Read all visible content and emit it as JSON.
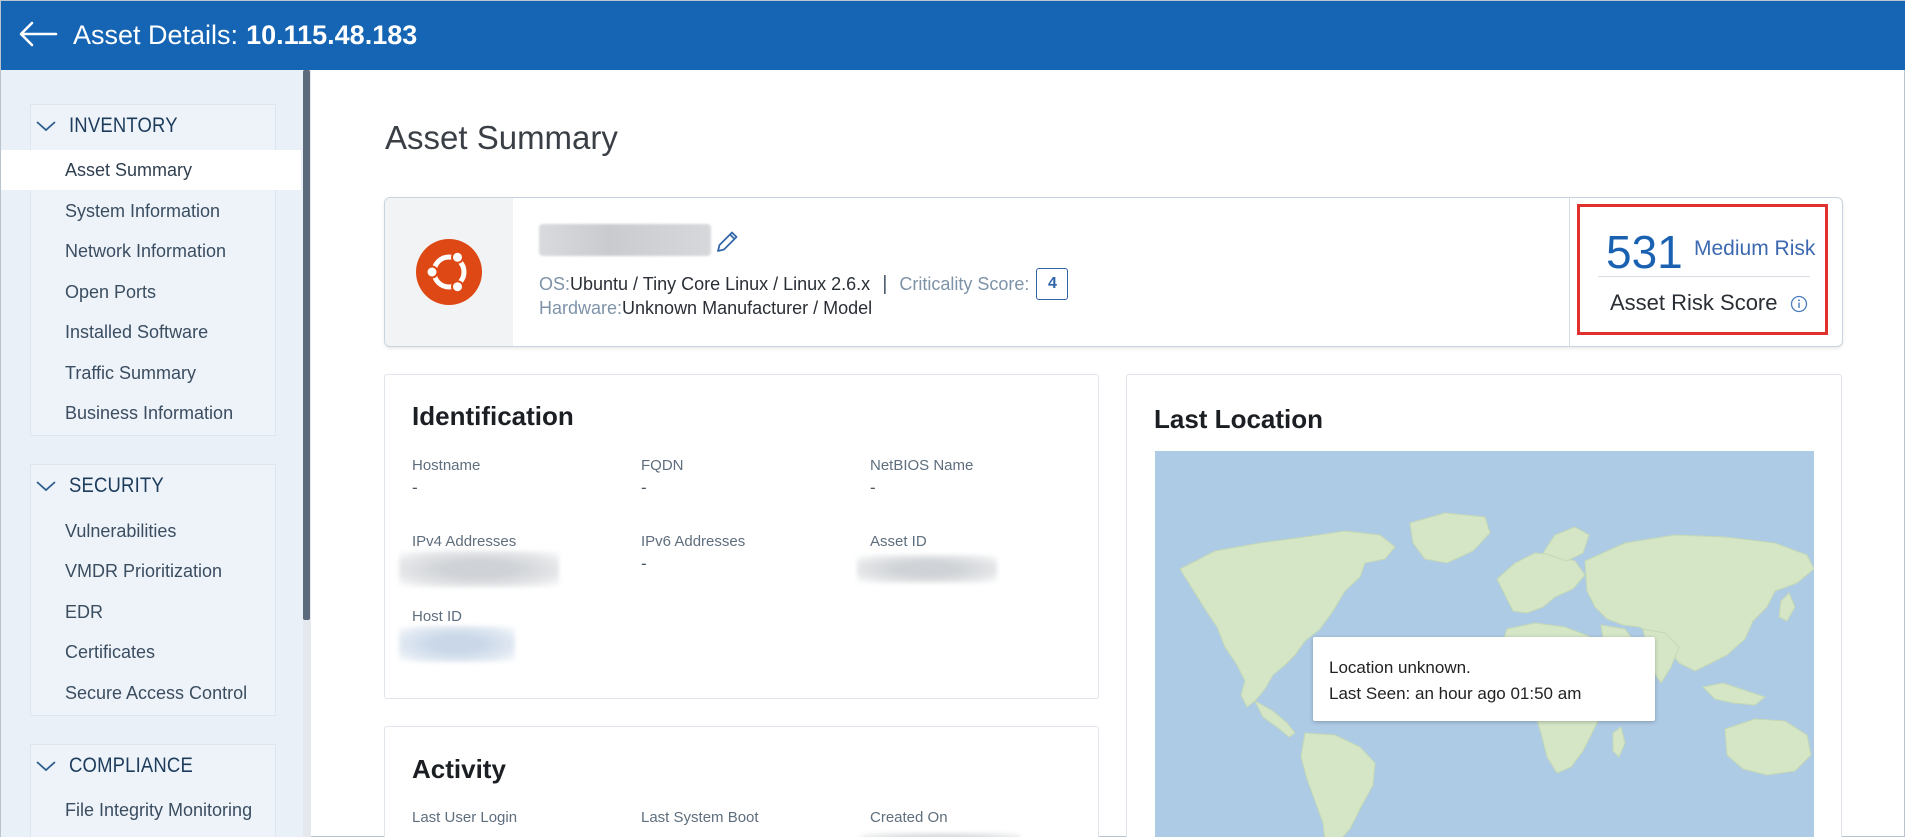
{
  "header": {
    "title_label": "Asset Details:",
    "title_value": "10.115.48.183"
  },
  "sidebar": {
    "groups": [
      {
        "label": "INVENTORY",
        "items": [
          "Asset Summary",
          "System Information",
          "Network Information",
          "Open Ports",
          "Installed Software",
          "Traffic Summary",
          "Business Information"
        ]
      },
      {
        "label": "SECURITY",
        "items": [
          "Vulnerabilities",
          "VMDR Prioritization",
          "EDR",
          "Certificates",
          "Secure Access Control"
        ]
      },
      {
        "label": "COMPLIANCE",
        "items": [
          "File Integrity Monitoring"
        ]
      }
    ],
    "active_item": "Asset Summary"
  },
  "main": {
    "page_title": "Asset Summary",
    "summary": {
      "os_label": "OS:",
      "os_value": "Ubuntu / Tiny Core Linux / Linux 2.6.x",
      "criticality_label": "Criticality Score:",
      "criticality_value": "4",
      "hardware_label": "Hardware:",
      "hardware_value": "Unknown Manufacturer / Model",
      "risk_score": "531",
      "risk_level": "Medium Risk",
      "risk_label": "Asset Risk Score",
      "os_icon": "ubuntu-logo-icon",
      "highlight_color": "#e0312f"
    },
    "identification": {
      "title": "Identification",
      "fields": {
        "hostname": {
          "label": "Hostname",
          "value": "-"
        },
        "fqdn": {
          "label": "FQDN",
          "value": "-"
        },
        "netbios": {
          "label": "NetBIOS Name",
          "value": "-"
        },
        "ipv4": {
          "label": "IPv4 Addresses"
        },
        "ipv6": {
          "label": "IPv6 Addresses",
          "value": "-"
        },
        "asset_id": {
          "label": "Asset ID"
        },
        "host_id": {
          "label": "Host ID"
        }
      }
    },
    "activity": {
      "title": "Activity",
      "fields": {
        "last_user_login": {
          "label": "Last User Login"
        },
        "last_system_boot": {
          "label": "Last System Boot"
        },
        "created_on": {
          "label": "Created On"
        }
      }
    },
    "last_location": {
      "title": "Last Location",
      "tooltip_line1": "Location unknown.",
      "tooltip_line2": "Last Seen: an hour ago 01:50 am"
    }
  },
  "colors": {
    "header_bg": "#1565b4",
    "sidebar_bg": "#e9f0f7",
    "map_water": "#aecbe6",
    "map_land": "#d5e6c6"
  }
}
